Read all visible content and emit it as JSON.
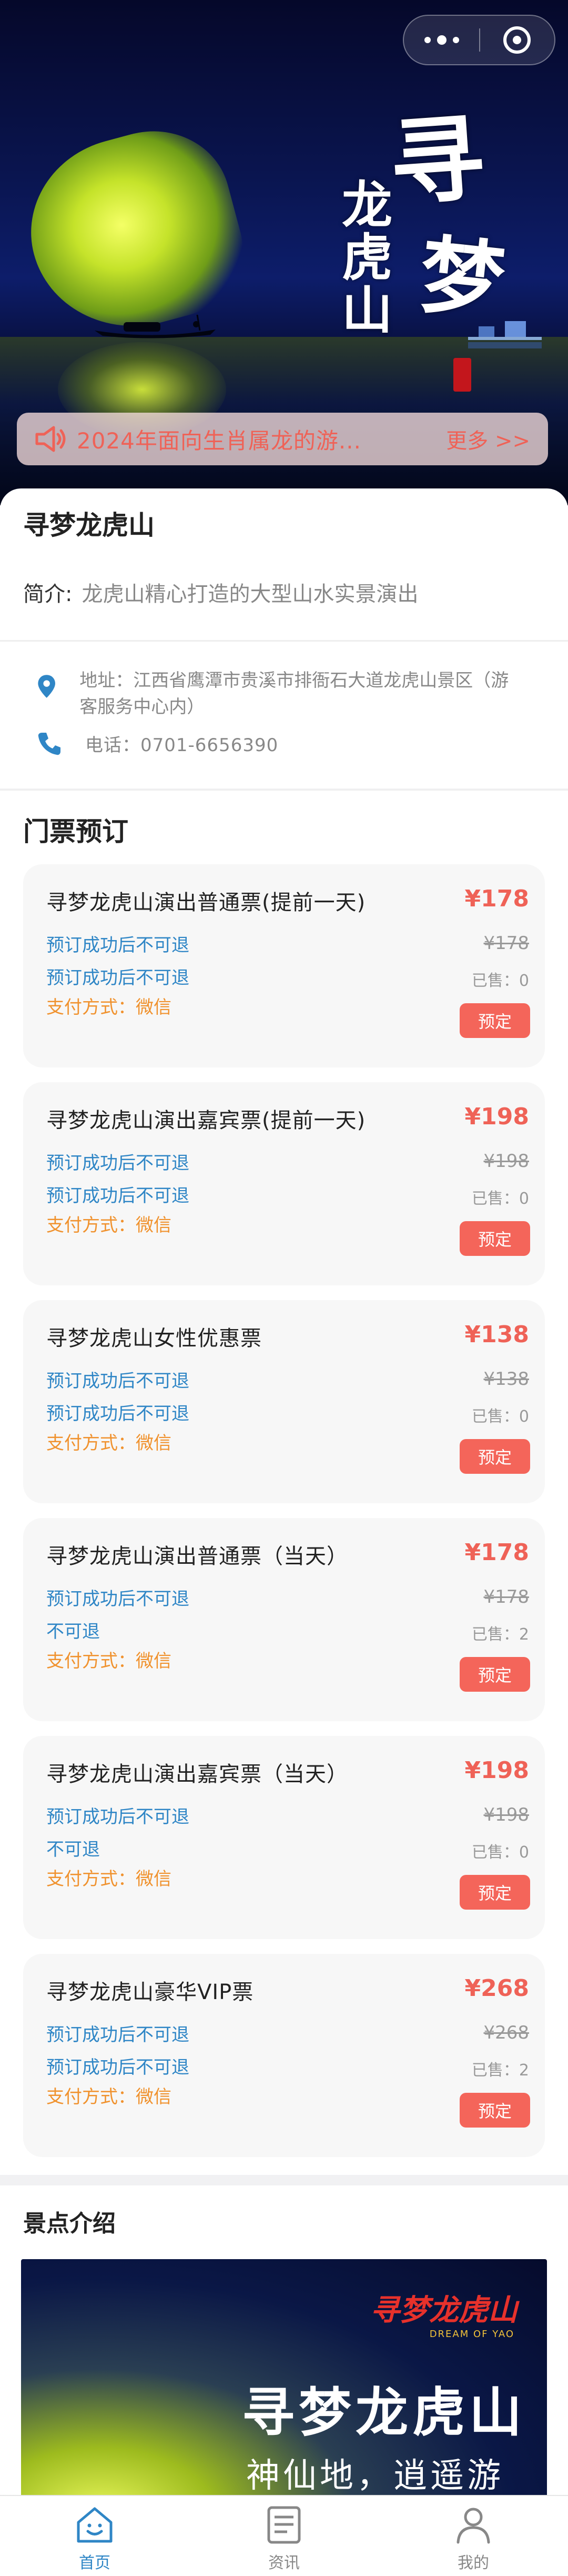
{
  "hero": {
    "brush_title_1": "寻",
    "brush_title_2": "梦",
    "brush_side": "龙虎山",
    "seal_text": "龙虎山"
  },
  "capsule": {
    "more_icon": "more-dots-icon",
    "close_icon": "target-close-icon"
  },
  "notice": {
    "text": "2024年面向生肖属龙的游...",
    "more_label": "更多 >>"
  },
  "info": {
    "title": "寻梦龙虎山",
    "intro_label": "简介:",
    "intro_value": "龙虎山精心打造的大型山水实景演出",
    "address": "地址：江西省鹰潭市贵溪市排衙石大道龙虎山景区（游客服务中心内）",
    "phone": "电话：0701-6656390"
  },
  "tickets": {
    "section_title": "门票预订",
    "items": [
      {
        "name": "寻梦龙虎山演出普通票(提前一天)",
        "price": "¥178",
        "line1": "预订成功后不可退",
        "line2": "预订成功后不可退",
        "pay": "支付方式：微信",
        "original": "¥178",
        "sold": "已售：0",
        "button": "预定"
      },
      {
        "name": "寻梦龙虎山演出嘉宾票(提前一天)",
        "price": "¥198",
        "line1": "预订成功后不可退",
        "line2": "预订成功后不可退",
        "pay": "支付方式：微信",
        "original": "¥198",
        "sold": "已售：0",
        "button": "预定"
      },
      {
        "name": "寻梦龙虎山女性优惠票",
        "price": "¥138",
        "line1": "预订成功后不可退",
        "line2": "预订成功后不可退",
        "pay": "支付方式：微信",
        "original": "¥138",
        "sold": "已售：0",
        "button": "预定"
      },
      {
        "name": "寻梦龙虎山演出普通票（当天）",
        "price": "¥178",
        "line1": "预订成功后不可退",
        "line2": "不可退",
        "pay": "支付方式：微信",
        "original": "¥178",
        "sold": "已售：2",
        "button": "预定"
      },
      {
        "name": "寻梦龙虎山演出嘉宾票（当天）",
        "price": "¥198",
        "line1": "预订成功后不可退",
        "line2": "不可退",
        "pay": "支付方式：微信",
        "original": "¥198",
        "sold": "已售：0",
        "button": "预定"
      },
      {
        "name": "寻梦龙虎山豪华VIP票",
        "price": "¥268",
        "line1": "预订成功后不可退",
        "line2": "预订成功后不可退",
        "pay": "支付方式：微信",
        "original": "¥268",
        "sold": "已售：2",
        "button": "预定"
      }
    ]
  },
  "scenic": {
    "section_title": "景点介绍",
    "banner_logo": "寻梦龙虎山",
    "banner_logo_sub": "DREAM OF YAO",
    "banner_title": "寻梦龙虎山",
    "banner_subtitle": "神仙地，逍遥游"
  },
  "tabbar": {
    "items": [
      {
        "label": "首页",
        "icon": "home-smile-icon",
        "active": true
      },
      {
        "label": "资讯",
        "icon": "news-icon",
        "active": false
      },
      {
        "label": "我的",
        "icon": "user-icon",
        "active": false
      }
    ]
  },
  "colors": {
    "accent_red": "#ef6257",
    "link_blue": "#2f86c6",
    "pay_orange": "#f0922e",
    "button_red": "#f4655a"
  }
}
